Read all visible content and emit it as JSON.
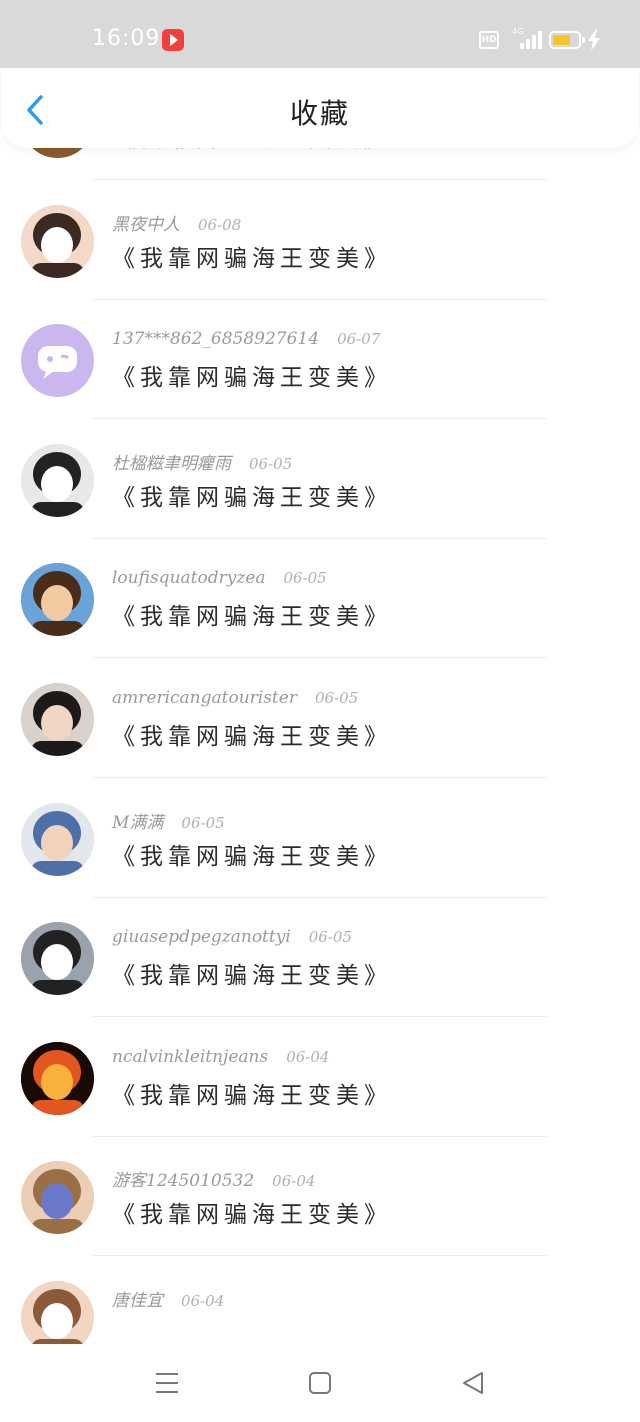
{
  "status_bar": {
    "time": "16:09",
    "hd_label": "HD",
    "network_label": "4G",
    "battery_level": 0.7,
    "battery_color": "#f5c52a"
  },
  "header": {
    "title": "收藏",
    "back_icon": "chevron-left-icon",
    "accent_color": "#2b9bf4"
  },
  "items": [
    {
      "user": "",
      "date": "",
      "title": "《我靠网骗海王变美》",
      "avatar": "brown-bear-avatar"
    },
    {
      "user": "黑夜中人",
      "date": "06-08",
      "title": "《我靠网骗海王变美》",
      "avatar": "girl-avatar"
    },
    {
      "user": "137***862_6858927614",
      "date": "06-07",
      "title": "《我靠网骗海王变美》",
      "avatar": "purple-chat-avatar"
    },
    {
      "user": "杜楹糍聿明癯雨",
      "date": "06-05",
      "title": "《我靠网骗海王变美》",
      "avatar": "masked-person-avatar"
    },
    {
      "user": "loufisquatodryzea",
      "date": "06-05",
      "title": "《我靠网骗海王变美》",
      "avatar": "cartoon-boy-avatar"
    },
    {
      "user": "amrericangatourister",
      "date": "06-05",
      "title": "《我靠网骗海王变美》",
      "avatar": "dark-hair-girl-avatar"
    },
    {
      "user": "M满满",
      "date": "06-05",
      "title": "《我靠网骗海王变美》",
      "avatar": "peeking-kid-avatar"
    },
    {
      "user": "giuasepdpegzanottyi",
      "date": "06-05",
      "title": "《我靠网骗海王变美》",
      "avatar": "striped-shirt-avatar"
    },
    {
      "user": "ncalvinkleitnjeans",
      "date": "06-04",
      "title": "《我靠网骗海王变美》",
      "avatar": "fire-figure-avatar"
    },
    {
      "user": "游客1245010532",
      "date": "06-04",
      "title": "《我靠网骗海王变美》",
      "avatar": "blonde-girl-avatar"
    },
    {
      "user": "唐佳宜",
      "date": "06-04",
      "title": "",
      "avatar": "smiling-girl-avatar"
    }
  ],
  "nav_bar": {
    "menu_icon": "menu-icon",
    "home_icon": "square-home-icon",
    "back_icon": "triangle-back-icon"
  }
}
